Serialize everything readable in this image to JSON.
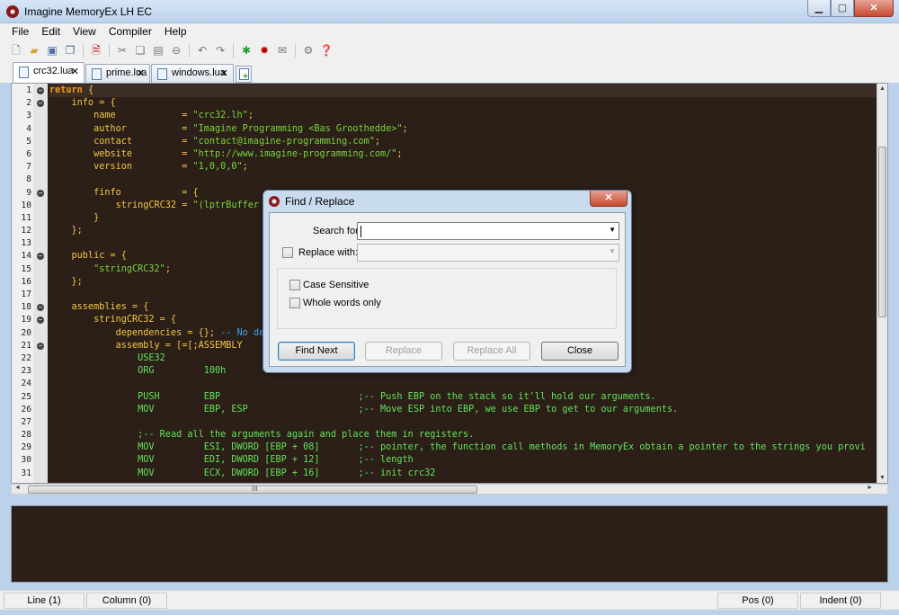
{
  "window": {
    "title": "Imagine MemoryEx LH EC",
    "minimize": "▁",
    "maximize": "▢",
    "close": "✕"
  },
  "menu": [
    "File",
    "Edit",
    "View",
    "Compiler",
    "Help"
  ],
  "toolbar": [
    "new-file",
    "open-file",
    "save",
    "save-all",
    "export",
    "cut",
    "copy",
    "paste",
    "delete",
    "undo",
    "redo",
    "build",
    "run",
    "mail",
    "settings",
    "help"
  ],
  "tabs": [
    {
      "label": "crc32.lua",
      "active": true
    },
    {
      "label": "prime.lua",
      "active": false
    },
    {
      "label": "windows.lua",
      "active": false
    }
  ],
  "tab_close": "✕",
  "new_tab_plus": "+",
  "editor": {
    "lines": [
      {
        "n": "1",
        "fold": "−",
        "code": "return {"
      },
      {
        "n": "2",
        "fold": "−",
        "code": "    info = {"
      },
      {
        "n": "3",
        "fold": "",
        "code": "        name            = \"crc32.lh\";"
      },
      {
        "n": "4",
        "fold": "",
        "code": "        author          = \"Imagine Programming <Bas Groothedde>\";"
      },
      {
        "n": "5",
        "fold": "",
        "code": "        contact         = \"contact@imagine-programming.com\";"
      },
      {
        "n": "6",
        "fold": "",
        "code": "        website         = \"http://www.imagine-programming.com/\";"
      },
      {
        "n": "7",
        "fold": "",
        "code": "        version         = \"1,0,0,0\";"
      },
      {
        "n": "8",
        "fold": "",
        "code": ""
      },
      {
        "n": "9",
        "fold": "−",
        "code": "        finfo           = {"
      },
      {
        "n": "10",
        "fold": "",
        "code": "            stringCRC32 = \"(lptrBuffer                                            buffer\";"
      },
      {
        "n": "11",
        "fold": "",
        "code": "        }"
      },
      {
        "n": "12",
        "fold": "",
        "code": "    };"
      },
      {
        "n": "13",
        "fold": "",
        "code": ""
      },
      {
        "n": "14",
        "fold": "−",
        "code": "    public = {"
      },
      {
        "n": "15",
        "fold": "",
        "code": "        \"stringCRC32\";"
      },
      {
        "n": "16",
        "fold": "",
        "code": "    };"
      },
      {
        "n": "17",
        "fold": "",
        "code": ""
      },
      {
        "n": "18",
        "fold": "−",
        "code": "    assemblies = {"
      },
      {
        "n": "19",
        "fold": "−",
        "code": "        stringCRC32 = {"
      },
      {
        "n": "20",
        "fold": "",
        "code": "            dependencies = {}; -- No de"
      },
      {
        "n": "21",
        "fold": "−",
        "code": "            assembly = [=[;ASSEMBLY"
      },
      {
        "n": "22",
        "fold": "",
        "code": "                USE32"
      },
      {
        "n": "23",
        "fold": "",
        "code": "                ORG         100h"
      },
      {
        "n": "24",
        "fold": "",
        "code": ""
      },
      {
        "n": "25",
        "fold": "",
        "code": "                PUSH        EBP                         ;-- Push EBP on the stack so it'll hold our arguments."
      },
      {
        "n": "26",
        "fold": "",
        "code": "                MOV         EBP, ESP                    ;-- Move ESP into EBP, we use EBP to get to our arguments."
      },
      {
        "n": "27",
        "fold": "",
        "code": ""
      },
      {
        "n": "28",
        "fold": "",
        "code": "                ;-- Read all the arguments again and place them in registers."
      },
      {
        "n": "29",
        "fold": "",
        "code": "                MOV         ESI, DWORD [EBP + 08]       ;-- pointer, the function call methods in MemoryEx obtain a pointer to the strings you provi"
      },
      {
        "n": "30",
        "fold": "",
        "code": "                MOV         EDI, DWORD [EBP + 12]       ;-- length"
      },
      {
        "n": "31",
        "fold": "",
        "code": "                MOV         ECX, DWORD [EBP + 16]       ;-- init crc32"
      }
    ]
  },
  "scroll": {
    "up": "▲",
    "down": "▼",
    "left": "◄",
    "right": "►",
    "grip": "III"
  },
  "status": {
    "line": "Line (1)",
    "column": "Column (0)",
    "pos": "Pos (0)",
    "indent": "Indent (0)"
  },
  "dialog": {
    "title": "Find / Replace",
    "close": "✕",
    "search_label": "Search for:",
    "search_value": "",
    "replace_label": "Replace with:",
    "case_sensitive": "Case Sensitive",
    "whole_words": "Whole words only",
    "buttons": {
      "find_next": "Find Next",
      "replace": "Replace",
      "replace_all": "Replace All",
      "close": "Close"
    },
    "dropdown": "▼"
  }
}
